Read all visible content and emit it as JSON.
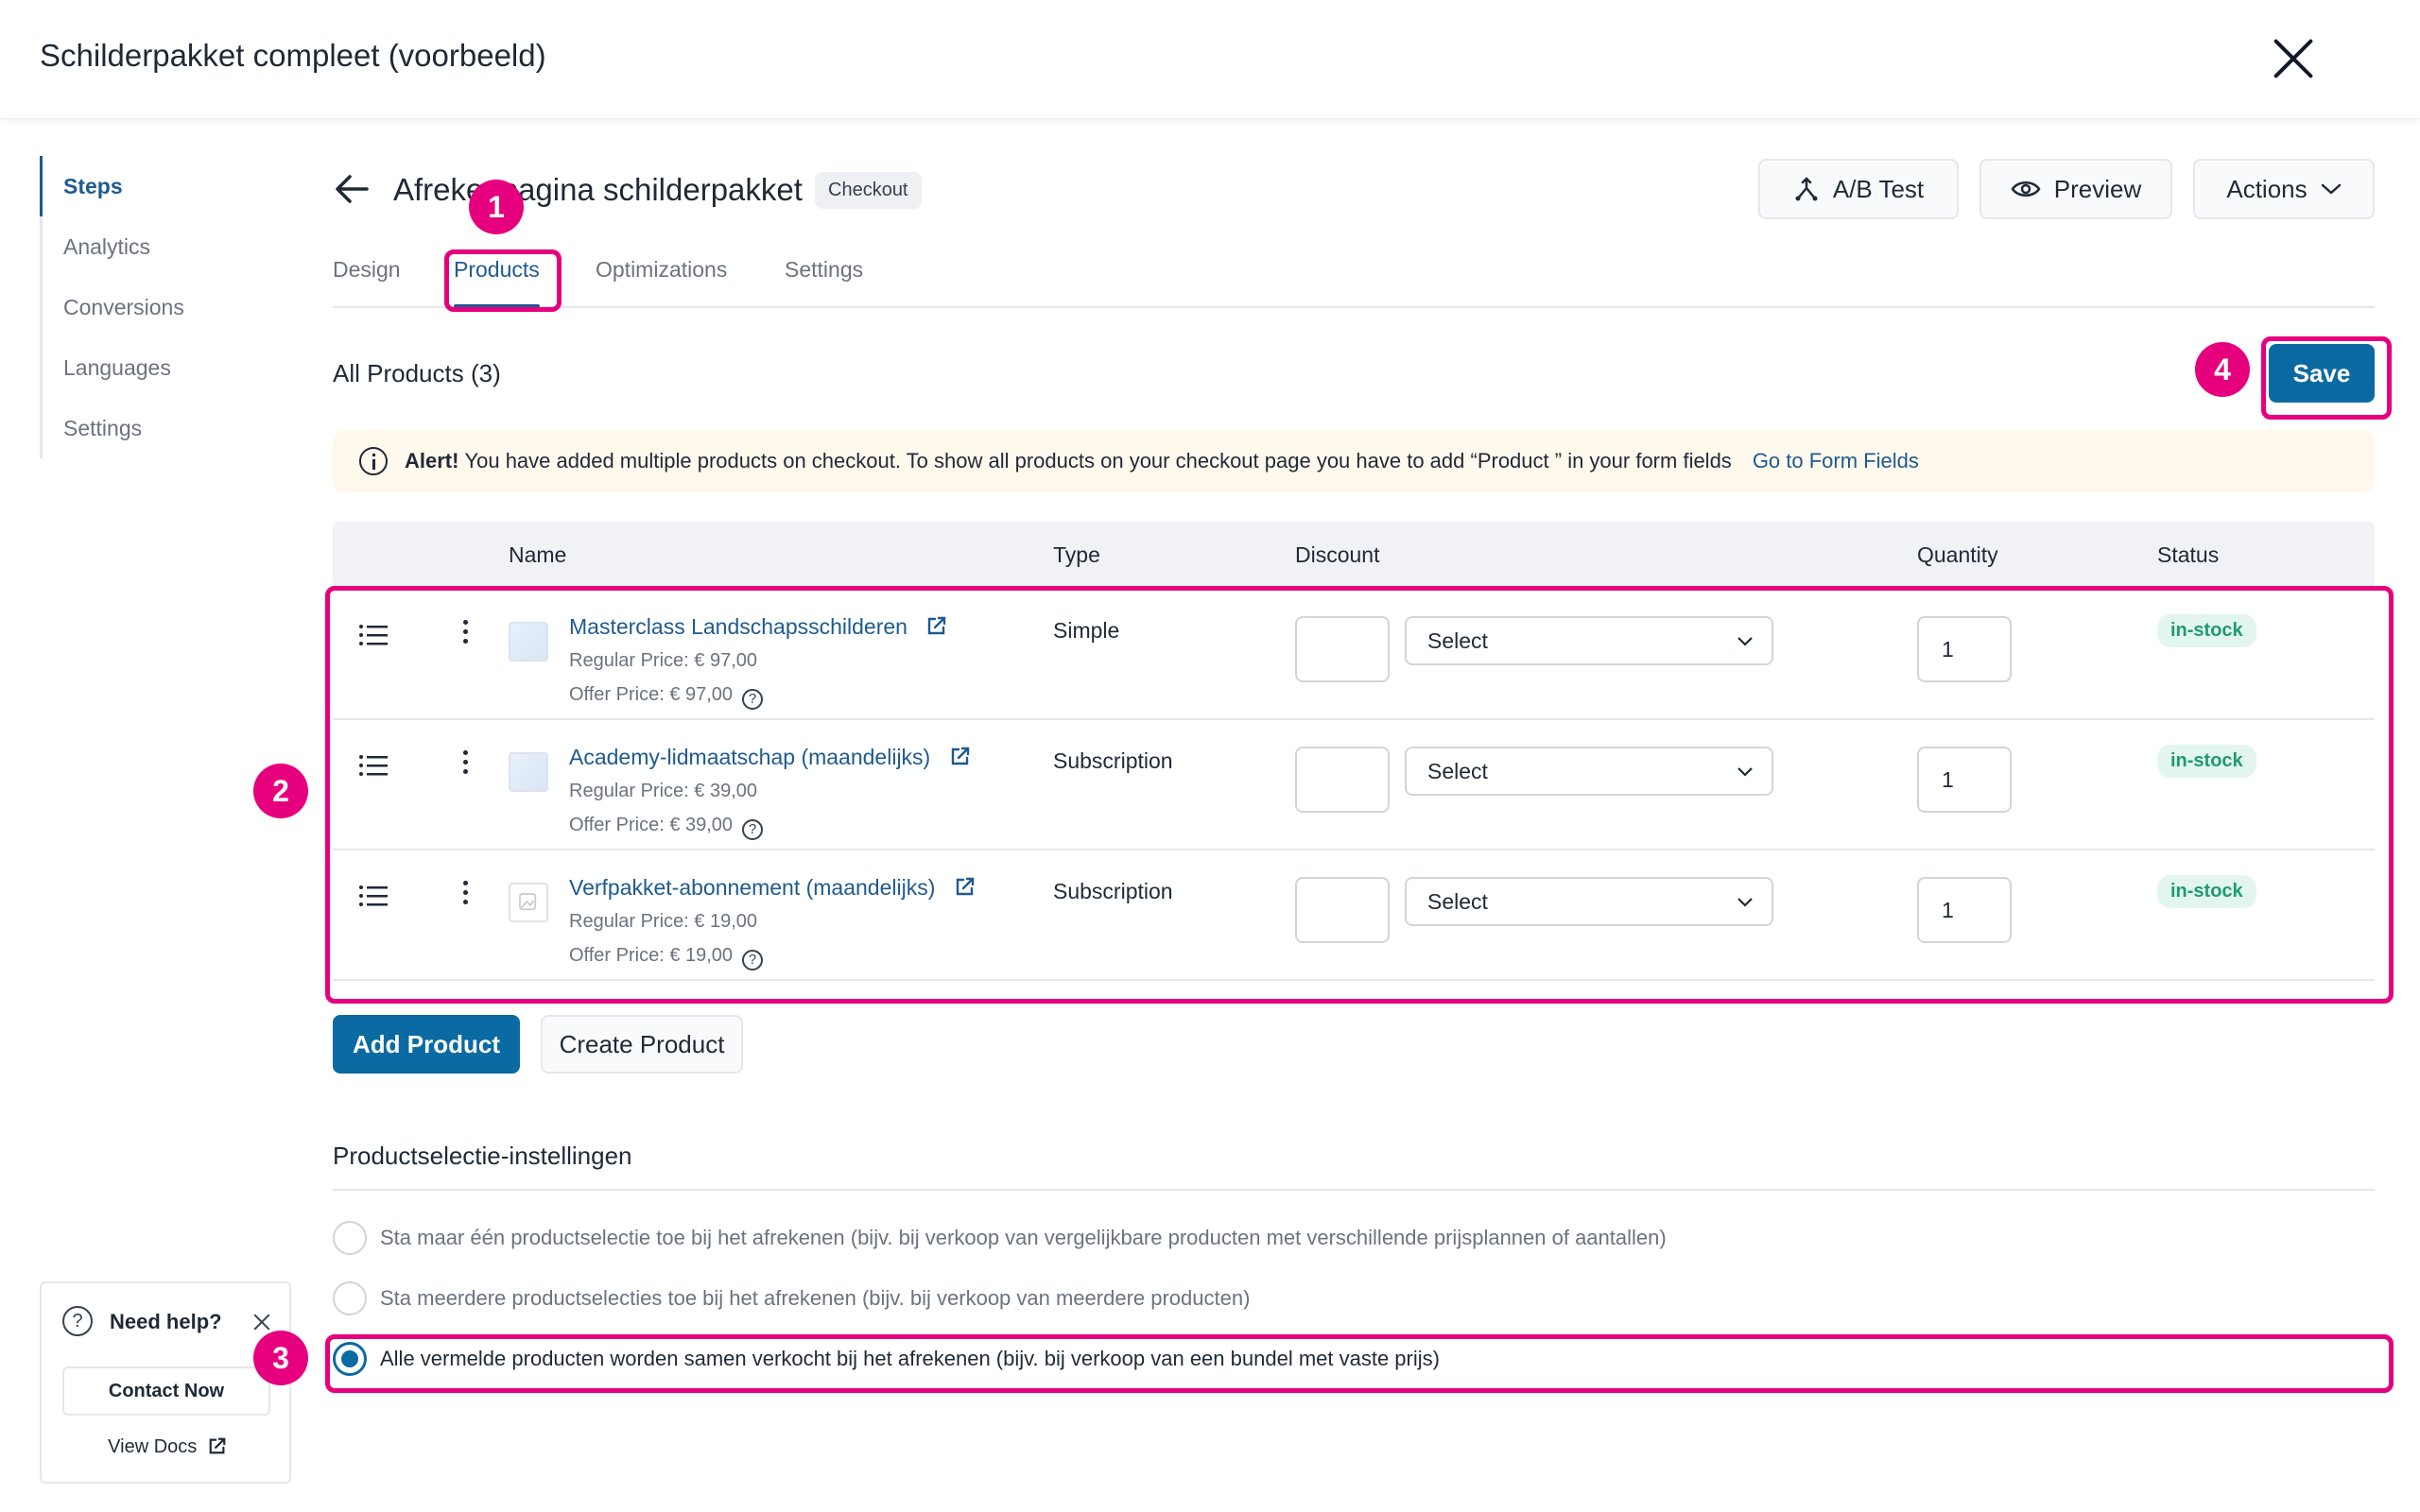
{
  "app": {
    "title": "Schilderpakket compleet (voorbeeld)"
  },
  "leftnav": {
    "items": [
      "Steps",
      "Analytics",
      "Conversions",
      "Languages",
      "Settings"
    ],
    "active": "Steps"
  },
  "header": {
    "title": "Afrekenpagina schilderpakket",
    "badge": "Checkout",
    "ab_test": "A/B Test",
    "preview": "Preview",
    "actions": "Actions"
  },
  "tabs": [
    "Design",
    "Products",
    "Optimizations",
    "Settings"
  ],
  "products": {
    "heading": "All Products (3)",
    "save": "Save",
    "alert": {
      "bold": "Alert!",
      "text": "You have added multiple products on checkout. To show all products on your checkout page you have to add “Product ” in your form fields",
      "link": "Go to Form Fields"
    },
    "columns": {
      "name": "Name",
      "type": "Type",
      "discount": "Discount",
      "quantity": "Quantity",
      "status": "Status"
    },
    "rows": [
      {
        "name": "Masterclass Landschapsschilderen",
        "regular": "Regular Price: € 97,00",
        "offer": "Offer Price: € 97,00",
        "type": "Simple",
        "select": "Select",
        "qty": "1",
        "status": "in-stock"
      },
      {
        "name": "Academy-lidmaatschap (maandelijks)",
        "regular": "Regular Price: € 39,00",
        "offer": "Offer Price: € 39,00",
        "type": "Subscription",
        "select": "Select",
        "qty": "1",
        "status": "in-stock"
      },
      {
        "name": "Verfpakket-abonnement (maandelijks)",
        "regular": "Regular Price: € 19,00",
        "offer": "Offer Price: € 19,00",
        "type": "Subscription",
        "select": "Select",
        "qty": "1",
        "status": "in-stock"
      }
    ],
    "add_product": "Add Product",
    "create_product": "Create Product"
  },
  "selection": {
    "heading": "Productselectie-instellingen",
    "options": [
      "Sta maar één productselectie toe bij het afrekenen (bijv. bij verkoop van vergelijkbare producten met verschillende prijsplannen of aantallen)",
      "Sta meerdere productselecties toe bij het afrekenen (bijv. bij verkoop van meerdere producten)",
      "Alle vermelde producten worden samen verkocht bij het afrekenen (bijv. bij verkoop van een bundel met vaste prijs)"
    ],
    "checked_index": 2
  },
  "help": {
    "title": "Need help?",
    "contact": "Contact Now",
    "docs": "View Docs"
  },
  "callouts": [
    "1",
    "2",
    "3",
    "4"
  ],
  "colors": {
    "accent": "#0b6aa2",
    "link": "#1e5a8f",
    "highlight": "#e6007e",
    "instock": "#1f9a70",
    "alert_bg": "#fff8ec"
  }
}
